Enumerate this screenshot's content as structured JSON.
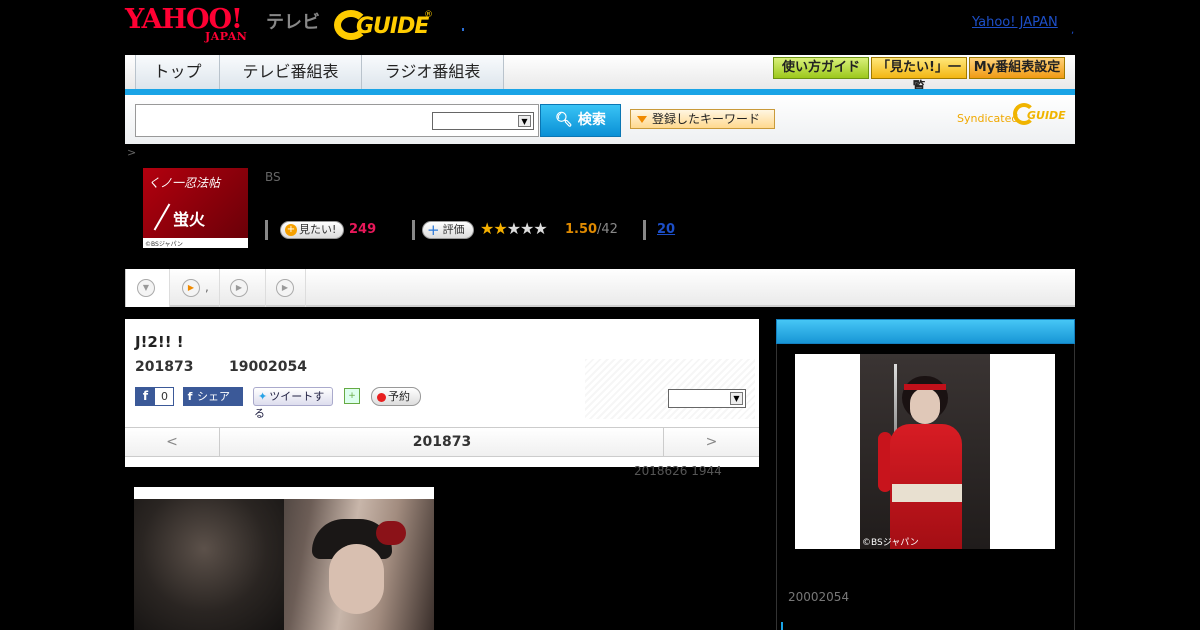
{
  "header": {
    "logo_yahoo": "YAHOO!",
    "logo_japan": "JAPAN",
    "logo_tv": "テレビ",
    "logo_gguide": "GUIDE",
    "logo_reg": "®",
    "top_link": "Yahoo! JAPAN",
    "top_link_tail": ","
  },
  "nav": {
    "tabs": [
      "トップ",
      "テレビ番組表",
      "ラジオ番組表"
    ],
    "buttons": [
      "使い方ガイド",
      "「見たい!」一覧",
      "My番組表設定"
    ]
  },
  "search": {
    "input_value": "",
    "select_value": "",
    "button_label": "検索",
    "keyword_button": "登録したキーワード",
    "syndicated_label": "Syndicated",
    "syndicated_logo": "GUIDE"
  },
  "breadcrumb": ">",
  "program": {
    "thumb_title_top": "くノ一忍法帖",
    "thumb_title_main": "蛍火",
    "thumb_copyright": "©BSジャパン",
    "channel": "BS",
    "want_label": "見たい!",
    "want_count": "249",
    "eval_label": "評価",
    "stars_on": "★★",
    "stars_off": "★★★",
    "rating": "1.50",
    "rating_count": "/42",
    "review_count": "20"
  },
  "subtabs": {
    "active_icon": "▼",
    "tab2_label": ",",
    "icon_play": "▶"
  },
  "episode": {
    "title": "J!2!! !",
    "date": "201873",
    "time": "19002054",
    "fb_like_count": "0",
    "fb_share_label": "シェア",
    "tweet_label": "ツイートする",
    "reserve_label": "予約",
    "select_value": "",
    "pager_prev": "<",
    "pager_date": "201873",
    "pager_next": ">",
    "updated": "2018626  1944"
  },
  "right_panel": {
    "copyright": "©BSジャパン",
    "time_text": "20002054"
  },
  "colors": {
    "accent_blue": "#1aa4e6",
    "yahoo_red": "#ff0033",
    "gguide_yellow": "#ffcc00",
    "want_pink": "#e8185a",
    "rating_orange": "#e08a00"
  }
}
